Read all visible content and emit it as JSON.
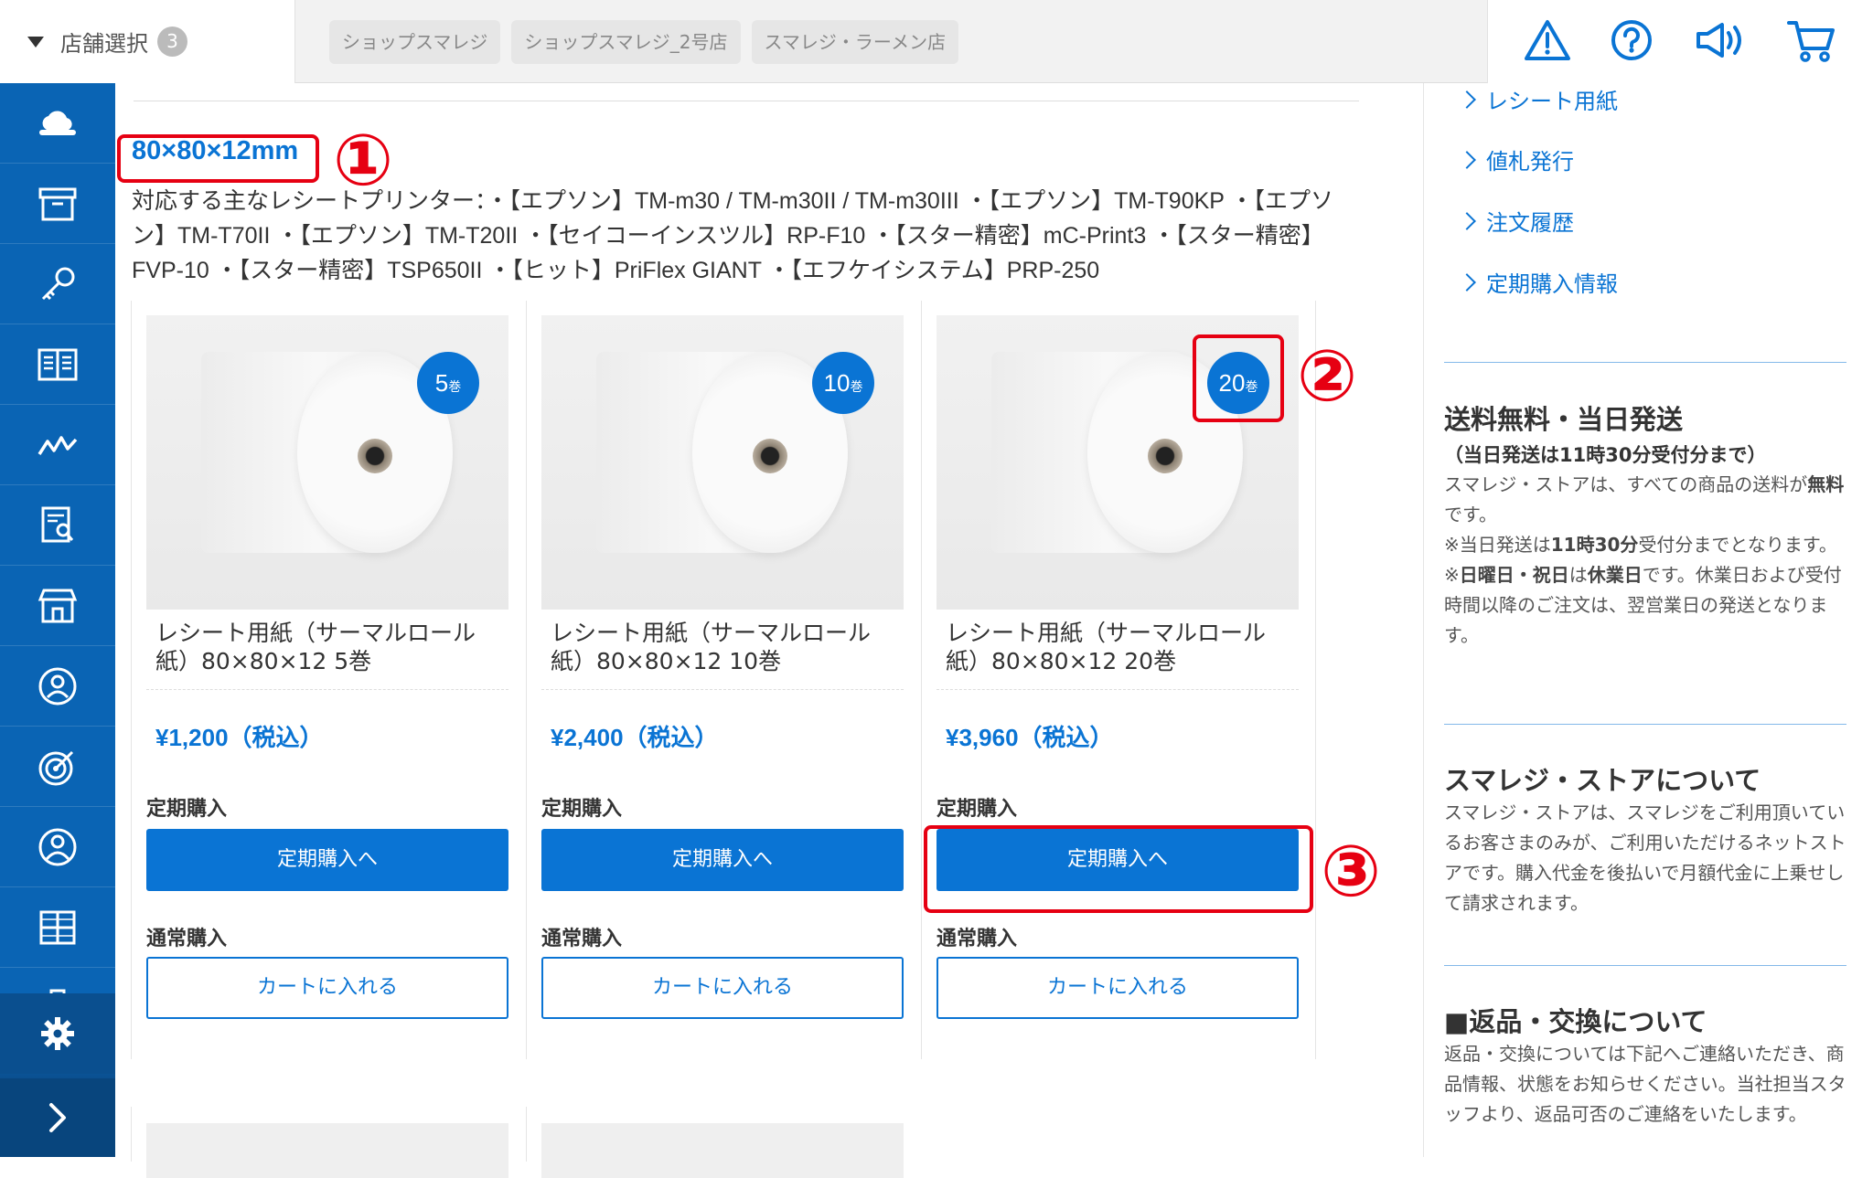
{
  "topbar": {
    "store_select_label": "店舗選択",
    "store_count": "3",
    "store_tabs": [
      "ショップスマレジ",
      "ショップスマレジ_2号店",
      "スマレジ・ラーメン店"
    ],
    "icons": [
      "warning-icon",
      "help-icon",
      "megaphone-icon",
      "cart-icon"
    ]
  },
  "sidenav": {
    "items": [
      "cloud-icon",
      "archive-icon",
      "key-icon",
      "book-icon",
      "chart-icon",
      "report-icon",
      "store-icon",
      "user-badge-icon",
      "target-icon",
      "person-icon",
      "apps-icon",
      "clipboard-icon"
    ],
    "settings": "gear-icon",
    "expand": "chevron-right-icon"
  },
  "main": {
    "size_title": "80×80×12mm",
    "printers": "対応する主なレシートプリンター：・【エプソン】TM-m30 / TM-m30II / TM-m30III ・【エプソン】TM-T90KP ・【エプソン】TM-T70II ・【エプソン】TM-T20II ・【セイコーインスツル】RP-F10 ・【スター精密】mC-Print3 ・【スター精密】FVP-10 ・【スター精密】TSP650II ・【ヒット】PriFlex GIANT ・【エフケイシステム】PRP-250",
    "products": [
      {
        "badge_num": "5",
        "badge_unit": "巻",
        "name": "レシート用紙（サーマルロール紙）80×80×12 5巻",
        "price": "¥1,200（税込）",
        "sub_label": "定期購入",
        "sub_button": "定期購入へ",
        "normal_label": "通常購入",
        "cart_button": "カートに入れる"
      },
      {
        "badge_num": "10",
        "badge_unit": "巻",
        "name": "レシート用紙（サーマルロール紙）80×80×12 10巻",
        "price": "¥2,400（税込）",
        "sub_label": "定期購入",
        "sub_button": "定期購入へ",
        "normal_label": "通常購入",
        "cart_button": "カートに入れる"
      },
      {
        "badge_num": "20",
        "badge_unit": "巻",
        "name": "レシート用紙（サーマルロール紙）80×80×12 20巻",
        "price": "¥3,960（税込）",
        "sub_label": "定期購入",
        "sub_button": "定期購入へ",
        "normal_label": "通常購入",
        "cart_button": "カートに入れる"
      }
    ]
  },
  "annotations": [
    "①",
    "②",
    "③"
  ],
  "right": {
    "links": [
      "レシート用紙",
      "値札発行",
      "注文履歴",
      "定期購入情報"
    ],
    "shipping": {
      "title": "送料無料・当日発送",
      "subtitle": "（当日発送は11時30分受付分まで）",
      "p1_a": "スマレジ・ストアは、すべての商品の送料が",
      "p1_b": "無料",
      "p1_c": "です。",
      "p2_a": "※当日発送は",
      "p2_b": "11時30分",
      "p2_c": "受付分までとなります。",
      "p3_a": "※",
      "p3_b": "日曜日・祝日",
      "p3_c": "は",
      "p3_d": "休業日",
      "p3_e": "です。休業日および受付時間以降のご注文は、翌営業日の発送となります。"
    },
    "about": {
      "title": "スマレジ・ストアについて",
      "text": "スマレジ・ストアは、スマレジをご利用頂いているお客さまのみが、ご利用いただけるネットストアです。購入代金を後払いで月額代金に上乗せして請求されます。"
    },
    "returns": {
      "title": "■返品・交換について",
      "text": "返品・交換については下記へご連絡いただき、商品情報、状態をお知らせください。当社担当スタッフより、返品可否のご連絡をいたします。"
    }
  }
}
